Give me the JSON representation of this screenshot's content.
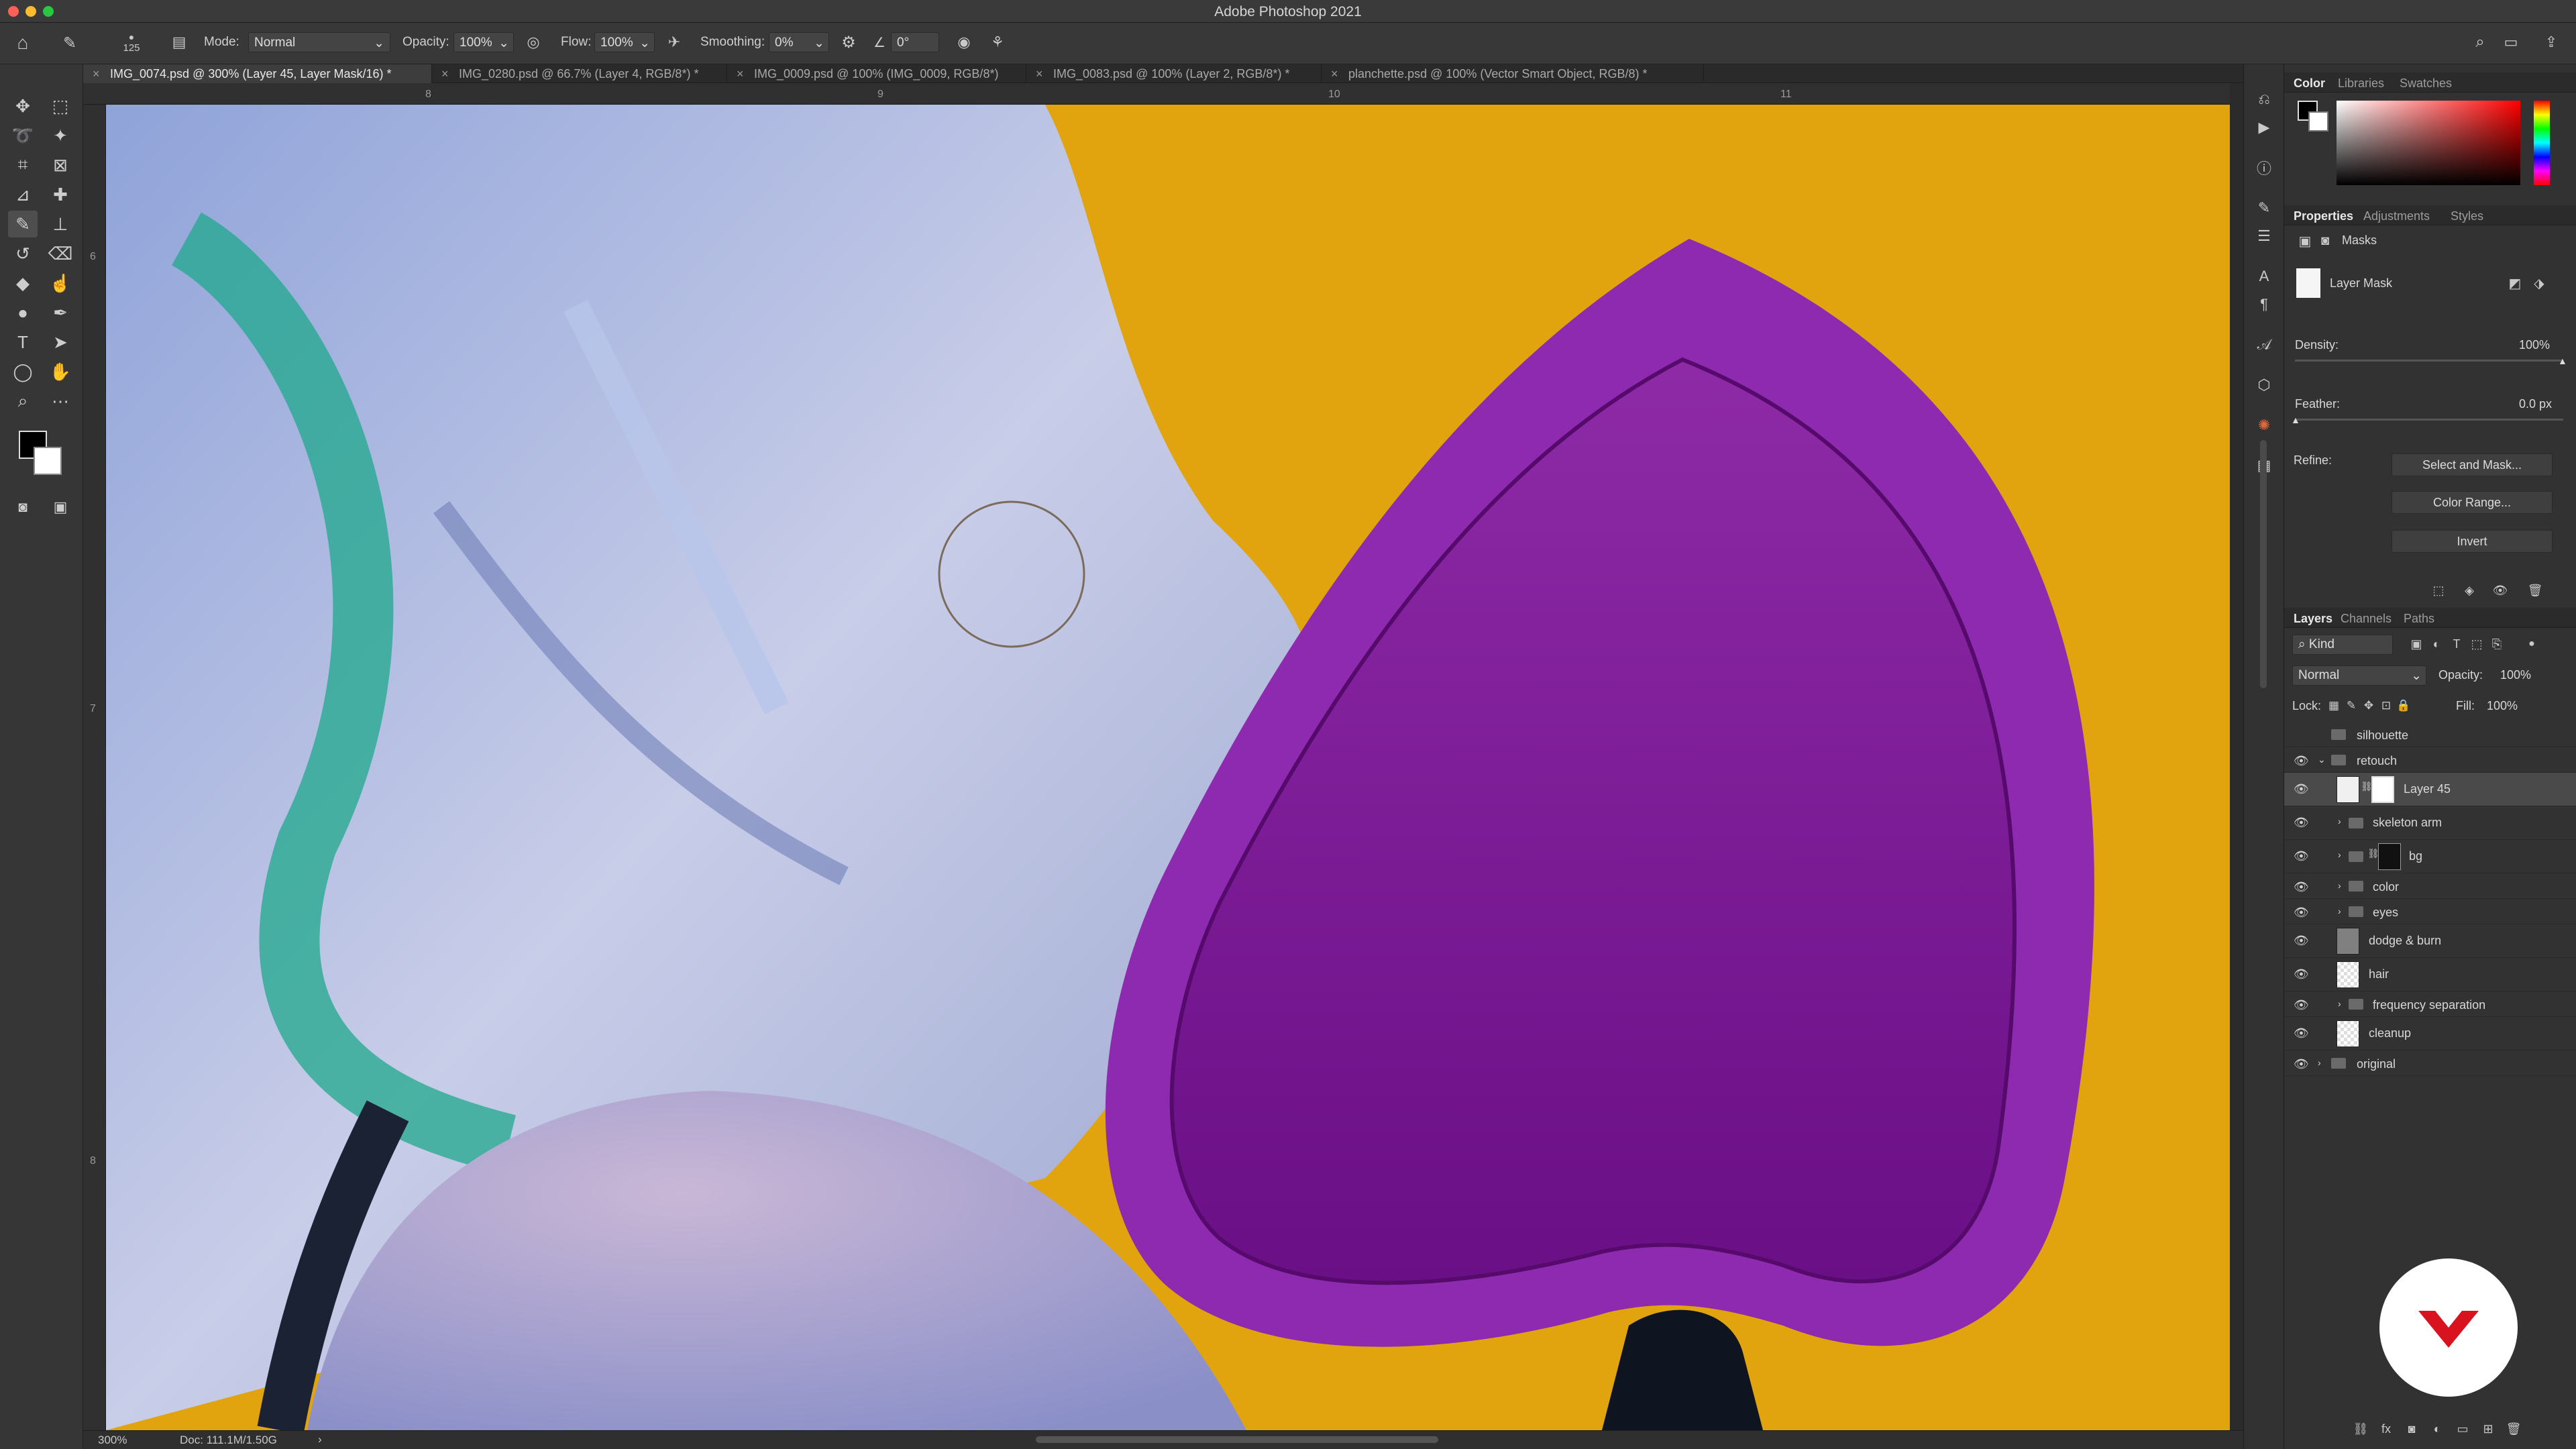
{
  "app": {
    "title": "Adobe Photoshop 2021"
  },
  "options": {
    "brush_size": "125",
    "mode_label": "Mode:",
    "mode_value": "Normal",
    "opacity_label": "Opacity:",
    "opacity_value": "100%",
    "flow_label": "Flow:",
    "flow_value": "100%",
    "smoothing_label": "Smoothing:",
    "smoothing_value": "0%",
    "angle_value": "0°"
  },
  "tabs": [
    {
      "label": "IMG_0074.psd @ 300% (Layer 45, Layer Mask/16) *"
    },
    {
      "label": "IMG_0280.psd @ 66.7% (Layer 4, RGB/8*) *"
    },
    {
      "label": "IMG_0009.psd @ 100% (IMG_0009, RGB/8*)"
    },
    {
      "label": "IMG_0083.psd @ 100% (Layer 2, RGB/8*) *"
    },
    {
      "label": "planchette.psd @ 100% (Vector Smart Object, RGB/8) *"
    }
  ],
  "ruler": {
    "top": [
      "8",
      "9",
      "10",
      "11"
    ],
    "left": [
      "6",
      "7",
      "8"
    ]
  },
  "status": {
    "zoom": "300%",
    "doc": "Doc: 111.1M/1.50G",
    "arrow": "›"
  },
  "color_panel": {
    "tabs": [
      "Color",
      "Libraries",
      "Swatches"
    ]
  },
  "properties": {
    "tabs": [
      "Properties",
      "Adjustments",
      "Styles"
    ],
    "section": "Masks",
    "mask_label": "Layer Mask",
    "density_label": "Density:",
    "density_value": "100%",
    "feather_label": "Feather:",
    "feather_value": "0.0 px",
    "refine_label": "Refine:",
    "btn_select_mask": "Select and Mask...",
    "btn_color_range": "Color Range...",
    "btn_invert": "Invert"
  },
  "layers_panel": {
    "tabs": [
      "Layers",
      "Channels",
      "Paths"
    ],
    "filter_kind": "Kind",
    "blend_mode": "Normal",
    "opacity_label": "Opacity:",
    "opacity_value": "100%",
    "lock_label": "Lock:",
    "fill_label": "Fill:",
    "fill_value": "100%",
    "layers": [
      {
        "name": "silhouette"
      },
      {
        "name": "retouch"
      },
      {
        "name": "Layer 45"
      },
      {
        "name": "skeleton arm"
      },
      {
        "name": "bg"
      },
      {
        "name": "color"
      },
      {
        "name": "eyes"
      },
      {
        "name": "dodge & burn"
      },
      {
        "name": "hair"
      },
      {
        "name": "frequency separation"
      },
      {
        "name": "cleanup"
      },
      {
        "name": "original"
      }
    ]
  }
}
